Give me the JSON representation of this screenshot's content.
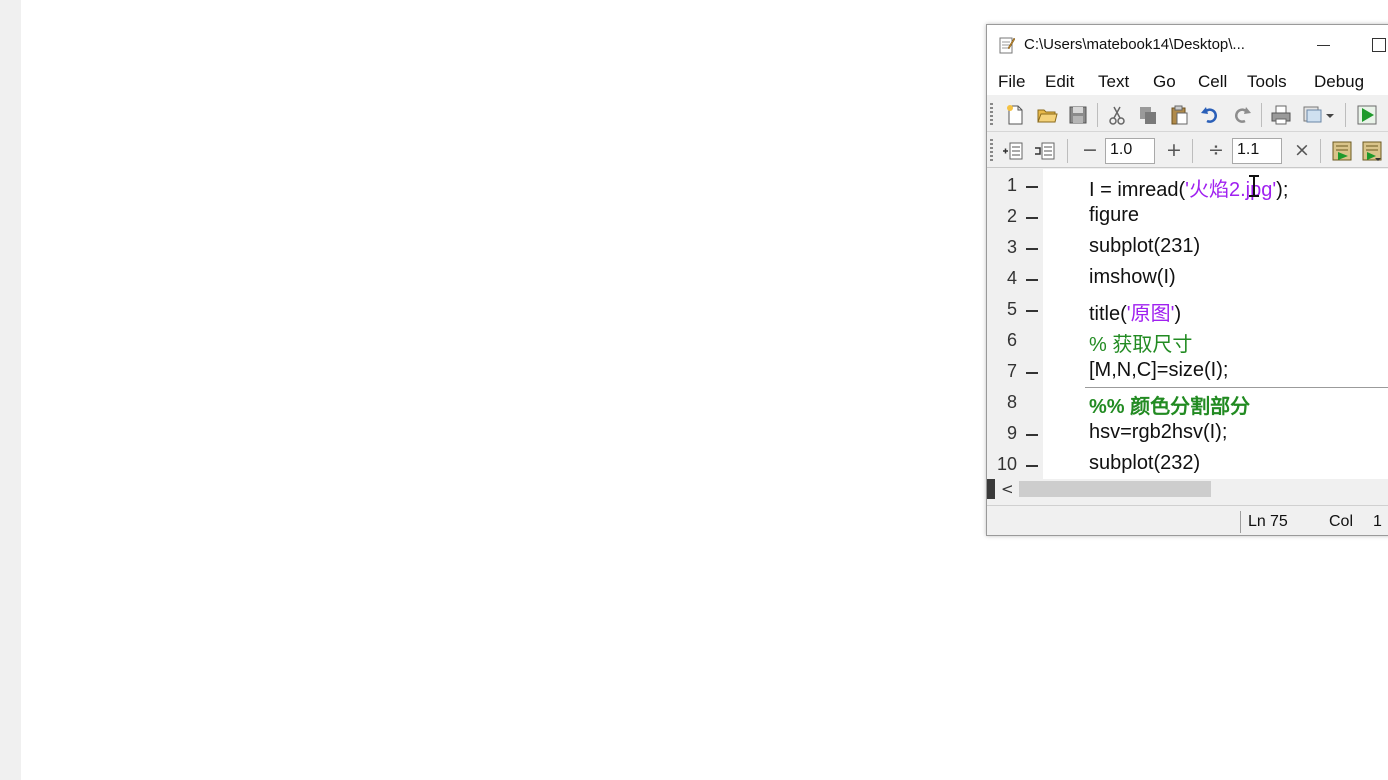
{
  "window": {
    "title": "C:\\Users\\matebook14\\Desktop\\..."
  },
  "menu": [
    "File",
    "Edit",
    "Text",
    "Go",
    "Cell",
    "Tools",
    "Debug"
  ],
  "cell_toolbar": {
    "decrement": "−",
    "increment_value": "1.0",
    "increment": "+",
    "divide": "÷",
    "divide_value": "1.1",
    "multiply": "×"
  },
  "editor": {
    "lines": [
      {
        "num": "1",
        "bp": true,
        "parts": [
          {
            "t": "I = imread(",
            "c": "plain"
          },
          {
            "t": "'火焰2.jpg'",
            "c": "str"
          },
          {
            "t": ");",
            "c": "plain"
          }
        ]
      },
      {
        "num": "2",
        "bp": true,
        "parts": [
          {
            "t": "figure",
            "c": "plain"
          }
        ]
      },
      {
        "num": "3",
        "bp": true,
        "parts": [
          {
            "t": "subplot(231)",
            "c": "plain"
          }
        ]
      },
      {
        "num": "4",
        "bp": true,
        "parts": [
          {
            "t": "imshow(I)",
            "c": "plain"
          }
        ]
      },
      {
        "num": "5",
        "bp": true,
        "parts": [
          {
            "t": "title(",
            "c": "plain"
          },
          {
            "t": "'原图'",
            "c": "str"
          },
          {
            "t": ")",
            "c": "plain"
          }
        ]
      },
      {
        "num": "6",
        "bp": false,
        "parts": [
          {
            "t": "% 获取尺寸",
            "c": "cmt"
          }
        ]
      },
      {
        "num": "7",
        "bp": true,
        "parts": [
          {
            "t": "[M,N,C]=size(I);",
            "c": "plain"
          }
        ]
      },
      {
        "num": "8",
        "bp": false,
        "parts": [
          {
            "t": "%% 颜色分割部分",
            "c": "cell-cmt"
          }
        ]
      },
      {
        "num": "9",
        "bp": true,
        "parts": [
          {
            "t": "hsv=rgb2hsv(I);",
            "c": "plain"
          }
        ]
      },
      {
        "num": "10",
        "bp": true,
        "parts": [
          {
            "t": "subplot(232)",
            "c": "plain"
          }
        ]
      }
    ]
  },
  "scrollbar": {
    "left_arrow": "<"
  },
  "status": {
    "ln_label": "Ln",
    "ln_value": "75",
    "col_label": "Col",
    "col_value": "1"
  },
  "colors": {
    "string": "#a020f0",
    "comment": "#228b22"
  }
}
